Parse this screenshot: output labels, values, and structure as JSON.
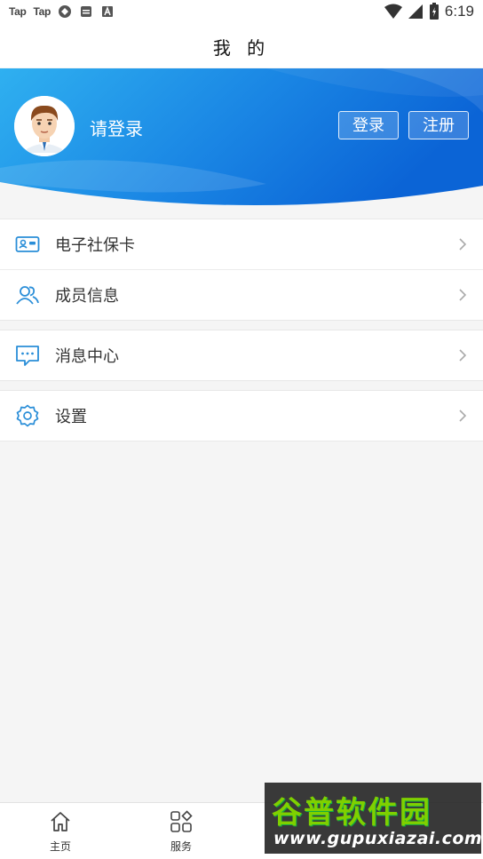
{
  "status_bar": {
    "app_icons": [
      "Tap",
      "Tap"
    ],
    "time": "6:19"
  },
  "header": {
    "title": "我 的"
  },
  "profile": {
    "login_prompt": "请登录",
    "login_button": "登录",
    "register_button": "注册"
  },
  "menu": {
    "groups": [
      [
        {
          "label": "电子社保卡",
          "icon": "social-security-card-icon"
        },
        {
          "label": "成员信息",
          "icon": "members-icon"
        }
      ],
      [
        {
          "label": "消息中心",
          "icon": "message-icon"
        }
      ],
      [
        {
          "label": "设置",
          "icon": "settings-icon"
        }
      ]
    ]
  },
  "bottom_nav": {
    "items": [
      {
        "label": "主页",
        "icon": "home-icon"
      },
      {
        "label": "服务",
        "icon": "services-icon"
      }
    ]
  },
  "watermark": {
    "title": "谷普软件园",
    "url": "www.gupuxiazai.com"
  },
  "colors": {
    "accent": "#1a7fe0",
    "banner_light": "#2aa6ee",
    "banner_dark": "#0b6bd8",
    "icon_blue": "#2a8ed8"
  }
}
